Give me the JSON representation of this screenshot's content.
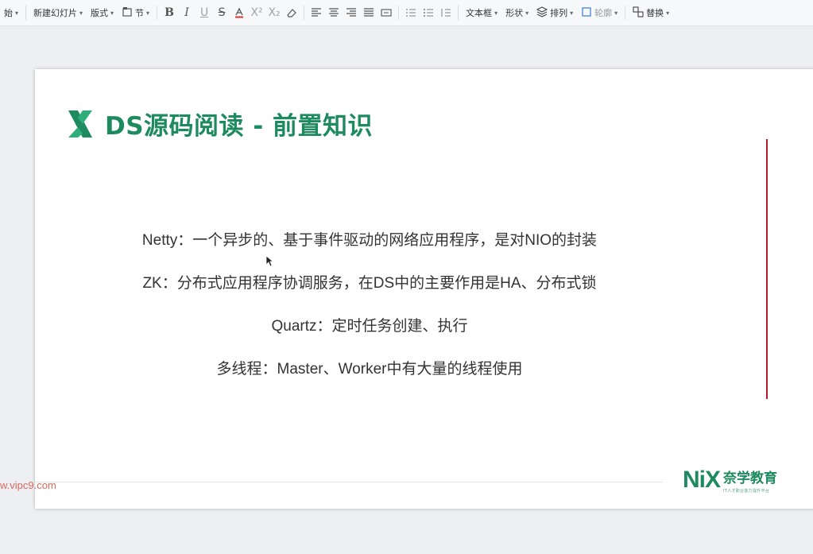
{
  "toolbar": {
    "start_partial": "始",
    "new_slide": "新建幻灯片",
    "layout": "版式",
    "section": "节",
    "textbox": "文本框",
    "shape": "形状",
    "arrange": "排列",
    "outline": "轮廓",
    "replace": "替换"
  },
  "slide": {
    "title": "DS源码阅读 - 前置知识",
    "lines": [
      "Netty：一个异步的、基于事件驱动的网络应用程序，是对NIO的封装",
      "ZK：分布式应用程序协调服务，在DS中的主要作用是HA、分布式锁",
      "Quartz：定时任务创建、执行",
      "多线程：Master、Worker中有大量的线程使用"
    ],
    "brand_logo": "NiX",
    "brand_name": "奈学教育",
    "brand_sub": "IT人才职业能力提升平台"
  },
  "watermark": "w.vipc9.com",
  "colors": {
    "accent": "#1e8a60",
    "red_line": "#b21c2a",
    "watermark": "#d76b5c"
  }
}
